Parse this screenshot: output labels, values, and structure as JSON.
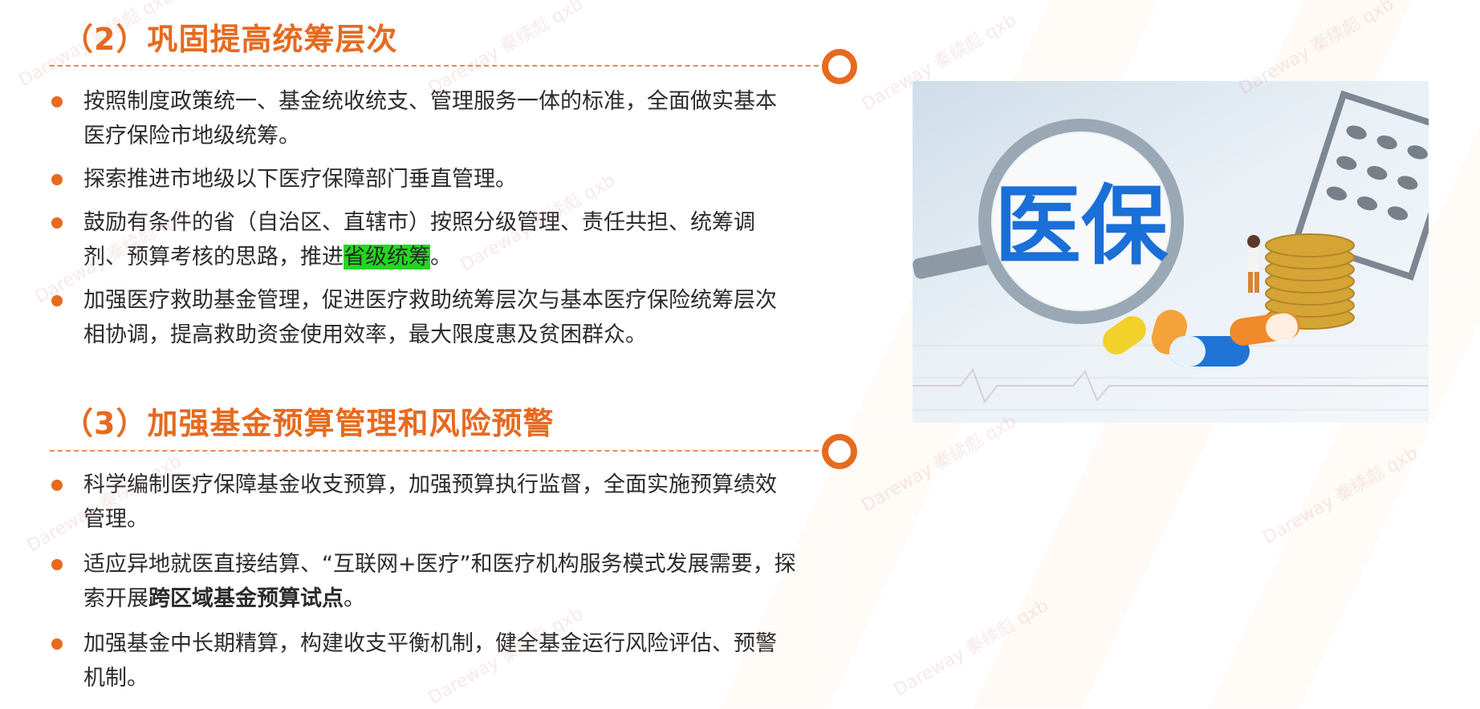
{
  "section2": {
    "title": "（2）巩固提高统筹层次",
    "items": [
      {
        "text": "按照制度政策统一、基金统收统支、管理服务一体的标准，全面做实基本医疗保险市地级统筹。"
      },
      {
        "text": "探索推进市地级以下医疗保障部门垂直管理。"
      },
      {
        "pre": "鼓励有条件的省（自治区、直辖市）按照分级管理、责任共担、统筹调剂、预算考核的思路，推进",
        "highlight": "省级统筹",
        "post": "。"
      },
      {
        "text": "加强医疗救助基金管理，促进医疗救助统筹层次与基本医疗保险统筹层次相协调，提高救助资金使用效率，最大限度惠及贫困群众。"
      }
    ]
  },
  "section3": {
    "title": "（3）加强基金预算管理和风险预警",
    "items": [
      {
        "text": "科学编制医疗保障基金收支预算，加强预算执行监督，全面实施预算绩效管理。"
      },
      {
        "pre": "适应异地就医直接结算、“互联网+医疗”和医疗机构服务模式发展需要，探索开展",
        "bold": "跨区域基金预算试点",
        "post": "。"
      },
      {
        "text": "加强基金中长期精算，构建收支平衡机制，健全基金运行风险评估、预警机制。"
      }
    ]
  },
  "photo": {
    "sign_text": "医保"
  },
  "watermark": {
    "text": "Dareway 秦续彪 qxb"
  },
  "colors": {
    "accent": "#e66a1f",
    "highlight": "#22d81e",
    "sign_blue": "#1a6fd8"
  }
}
